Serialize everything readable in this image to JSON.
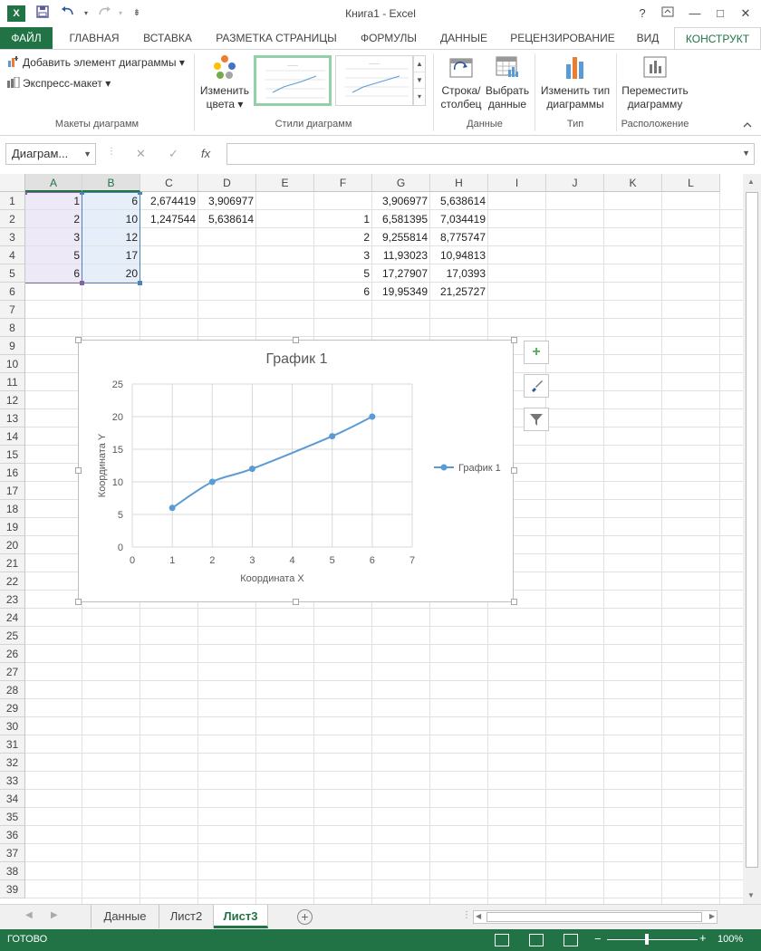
{
  "window": {
    "title": "Книга1 - Excel",
    "app_icon": "X",
    "help": "?",
    "minimize": "—",
    "maximize": "□",
    "close": "✕"
  },
  "tabs": [
    {
      "label": "ФАЙЛ"
    },
    {
      "label": "ГЛАВНАЯ"
    },
    {
      "label": "ВСТАВКА"
    },
    {
      "label": "РАЗМЕТКА СТРАНИЦЫ"
    },
    {
      "label": "ФОРМУЛЫ"
    },
    {
      "label": "ДАННЫЕ"
    },
    {
      "label": "РЕЦЕНЗИРОВАНИЕ"
    },
    {
      "label": "ВИД"
    },
    {
      "label": "КОНСТРУКТ"
    }
  ],
  "ribbon": {
    "add_element": "Добавить элемент диаграммы",
    "quick_layout": "Экспресс-макет",
    "group_layouts": "Макеты диаграмм",
    "change_colors": "Изменить цвета",
    "group_styles": "Стили диаграмм",
    "switch_row_col": "Строка/ столбец",
    "select_data": "Выбрать данные",
    "group_data": "Данные",
    "change_type": "Изменить тип диаграммы",
    "group_type": "Тип",
    "move_chart": "Переместить диаграмму",
    "group_location": "Расположение"
  },
  "formula_bar": {
    "name_box": "Диаграм...",
    "fx": "fx",
    "cancel": "✕",
    "enter": "✓",
    "value": ""
  },
  "columns": [
    "A",
    "B",
    "C",
    "D",
    "E",
    "F",
    "G",
    "H",
    "I",
    "J",
    "K",
    "L"
  ],
  "rows": [
    "1",
    "2",
    "3",
    "4",
    "5",
    "6",
    "7",
    "8",
    "9",
    "10",
    "11",
    "12",
    "13",
    "14",
    "15",
    "16",
    "17",
    "18",
    "19",
    "20",
    "21",
    "22",
    "23",
    "24",
    "25",
    "26",
    "27",
    "28",
    "29",
    "30",
    "31",
    "32",
    "33",
    "34",
    "35",
    "36",
    "37",
    "38",
    "39"
  ],
  "cells": [
    {
      "r": 0,
      "c": 0,
      "v": "1"
    },
    {
      "r": 0,
      "c": 1,
      "v": "6"
    },
    {
      "r": 0,
      "c": 2,
      "v": "2,674419"
    },
    {
      "r": 0,
      "c": 3,
      "v": "3,906977"
    },
    {
      "r": 0,
      "c": 6,
      "v": "3,906977"
    },
    {
      "r": 0,
      "c": 7,
      "v": "5,638614"
    },
    {
      "r": 1,
      "c": 0,
      "v": "2"
    },
    {
      "r": 1,
      "c": 1,
      "v": "10"
    },
    {
      "r": 1,
      "c": 2,
      "v": "1,247544"
    },
    {
      "r": 1,
      "c": 3,
      "v": "5,638614"
    },
    {
      "r": 1,
      "c": 5,
      "v": "1"
    },
    {
      "r": 1,
      "c": 6,
      "v": "6,581395"
    },
    {
      "r": 1,
      "c": 7,
      "v": "7,034419"
    },
    {
      "r": 2,
      "c": 0,
      "v": "3"
    },
    {
      "r": 2,
      "c": 1,
      "v": "12"
    },
    {
      "r": 2,
      "c": 5,
      "v": "2"
    },
    {
      "r": 2,
      "c": 6,
      "v": "9,255814"
    },
    {
      "r": 2,
      "c": 7,
      "v": "8,775747"
    },
    {
      "r": 3,
      "c": 0,
      "v": "5"
    },
    {
      "r": 3,
      "c": 1,
      "v": "17"
    },
    {
      "r": 3,
      "c": 5,
      "v": "3"
    },
    {
      "r": 3,
      "c": 6,
      "v": "11,93023"
    },
    {
      "r": 3,
      "c": 7,
      "v": "10,94813"
    },
    {
      "r": 4,
      "c": 0,
      "v": "6"
    },
    {
      "r": 4,
      "c": 1,
      "v": "20"
    },
    {
      "r": 4,
      "c": 5,
      "v": "5"
    },
    {
      "r": 4,
      "c": 6,
      "v": "17,27907"
    },
    {
      "r": 4,
      "c": 7,
      "v": "17,0393"
    },
    {
      "r": 5,
      "c": 5,
      "v": "6"
    },
    {
      "r": 5,
      "c": 6,
      "v": "19,95349"
    },
    {
      "r": 5,
      "c": 7,
      "v": "21,25727"
    }
  ],
  "chart_data": {
    "type": "scatter",
    "title": "График 1",
    "xlabel": "Координата X",
    "ylabel": "Координата Y",
    "xlim": [
      0,
      7
    ],
    "ylim": [
      0,
      25
    ],
    "x_ticks": [
      "0",
      "1",
      "2",
      "3",
      "4",
      "5",
      "6",
      "7"
    ],
    "y_ticks": [
      "0",
      "5",
      "10",
      "15",
      "20",
      "25"
    ],
    "grid": true,
    "legend_position": "right",
    "series": [
      {
        "name": "График 1",
        "color": "#5b9bd5",
        "x": [
          1,
          2,
          3,
          5,
          6
        ],
        "y": [
          6,
          10,
          12,
          17,
          20
        ]
      }
    ]
  },
  "side_buttons": [
    "+",
    "brush",
    "filter"
  ],
  "sheets": [
    {
      "label": "Данные",
      "active": false
    },
    {
      "label": "Лист2",
      "active": false
    },
    {
      "label": "Лист3",
      "active": true
    }
  ],
  "status": {
    "ready": "ГОТОВО",
    "zoom": "100%"
  }
}
